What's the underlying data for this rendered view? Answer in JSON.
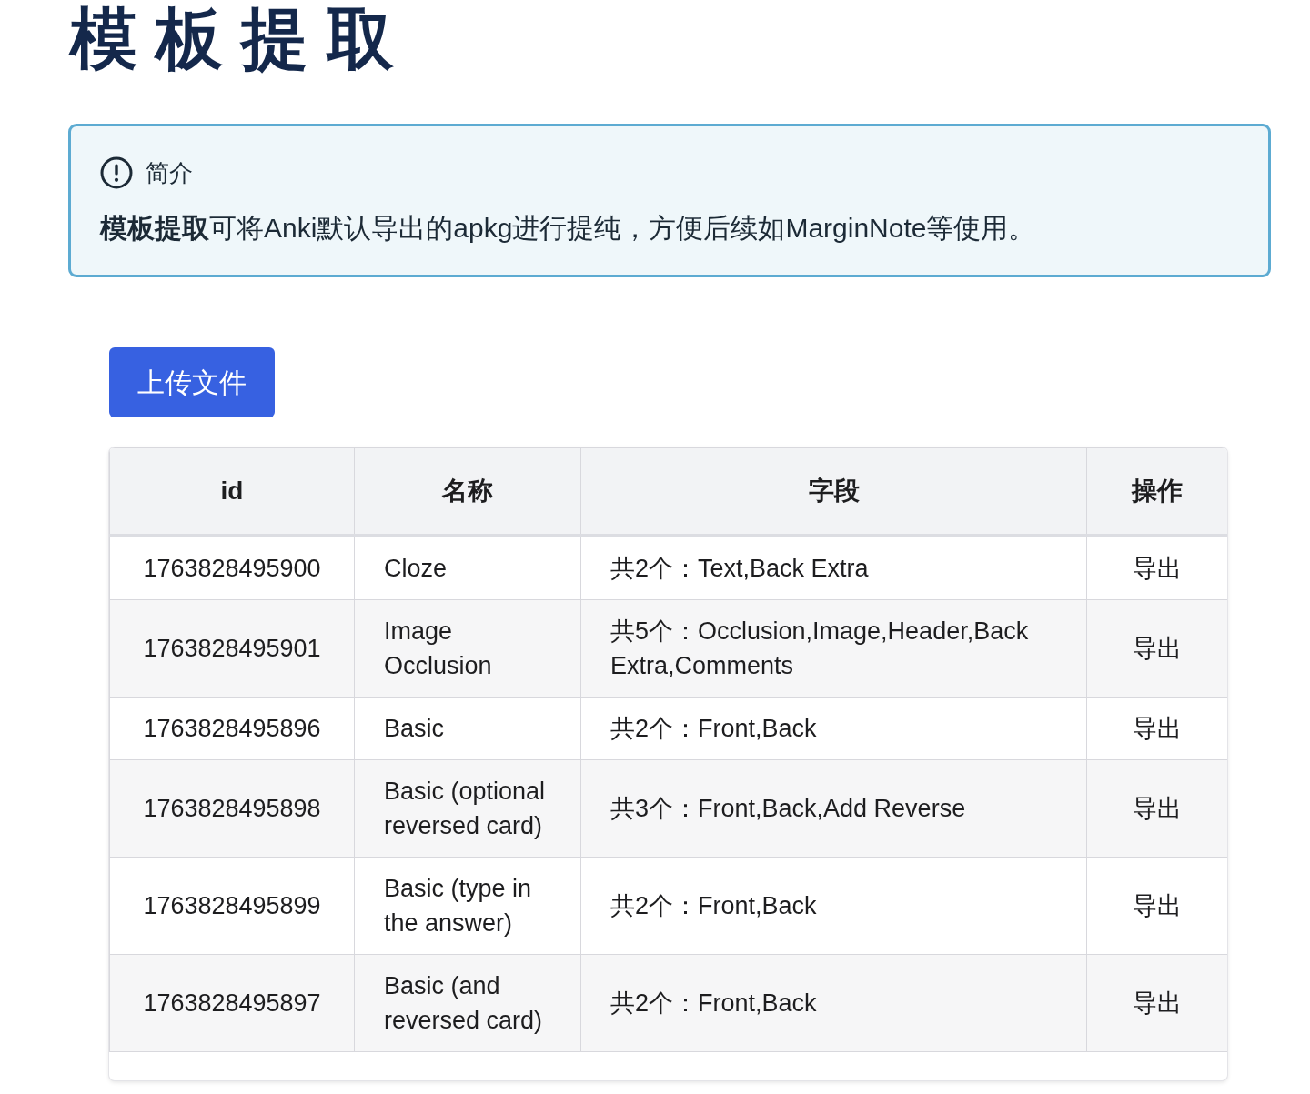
{
  "page": {
    "title": "模板提取"
  },
  "callout": {
    "heading": "简介",
    "text": "**模板提取**可将Anki默认导出的apkg进行提纯，方便后续如MarginNote等使用。"
  },
  "upload_button": {
    "label": "上传文件"
  },
  "table": {
    "columns": [
      "id",
      "名称",
      "字段",
      "操作"
    ],
    "rows": [
      {
        "id": "1763828495900",
        "name": "Cloze",
        "fields": "共2个：Text,Back Extra",
        "action": "导出"
      },
      {
        "id": "1763828495901",
        "name": "Image Occlusion",
        "fields": "共5个：Occlusion,Image,Header,Back Extra,Comments",
        "action": "导出"
      },
      {
        "id": "1763828495896",
        "name": "Basic",
        "fields": "共2个：Front,Back",
        "action": "导出"
      },
      {
        "id": "1763828495898",
        "name": "Basic (optional reversed card)",
        "fields": "共3个：Front,Back,Add Reverse",
        "action": "导出"
      },
      {
        "id": "1763828495899",
        "name": "Basic (type in the answer)",
        "fields": "共2个：Front,Back",
        "action": "导出"
      },
      {
        "id": "1763828495897",
        "name": "Basic (and reversed card)",
        "fields": "共2个：Front,Back",
        "action": "导出"
      }
    ]
  }
}
